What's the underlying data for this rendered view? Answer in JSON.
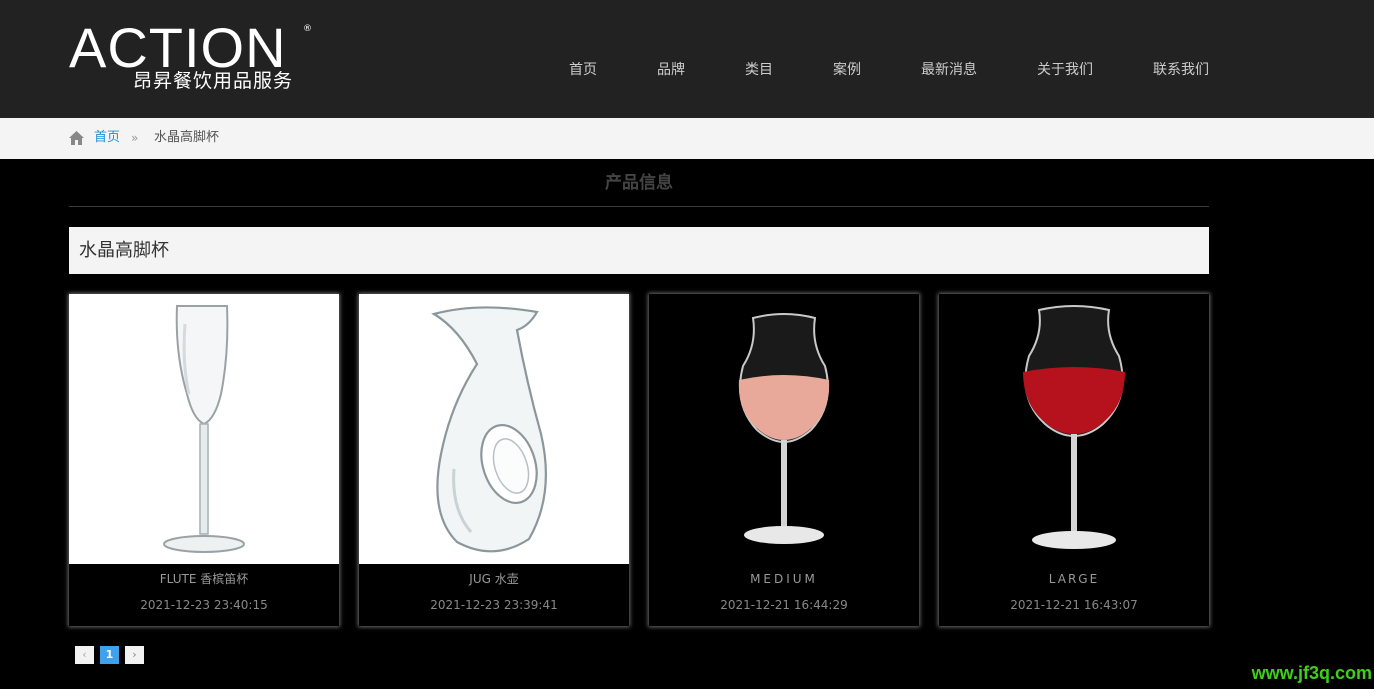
{
  "header": {
    "logo_main": "ACTION",
    "logo_reg": "®",
    "logo_sub": "昂昇餐饮用品服务",
    "nav": [
      "首页",
      "品牌",
      "类目",
      "案例",
      "最新消息",
      "关于我们",
      "联系我们"
    ]
  },
  "breadcrumb": {
    "home": "首页",
    "separator": "»",
    "current": "水晶高脚杯"
  },
  "section_title": "产品信息",
  "category_title": "水晶高脚杯",
  "products": [
    {
      "name": "FLUTE 香槟笛杯",
      "date": "2021-12-23 23:40:15",
      "image": "flute-glass"
    },
    {
      "name": "JUG 水壶",
      "date": "2021-12-23 23:39:41",
      "image": "jug-carafe"
    },
    {
      "name": "MEDIUM",
      "date": "2021-12-21 16:44:29",
      "image": "medium-glass-rose"
    },
    {
      "name": "LARGE",
      "date": "2021-12-21 16:43:07",
      "image": "large-glass-red"
    }
  ],
  "pagination": {
    "prev": "‹",
    "current": "1",
    "next": "›"
  },
  "watermark": "www.jf3q.com",
  "colors": {
    "header_bg": "#222222",
    "link_blue": "#1e90d6",
    "page_active": "#3fa0ee",
    "watermark_green": "#3ecf1a"
  }
}
